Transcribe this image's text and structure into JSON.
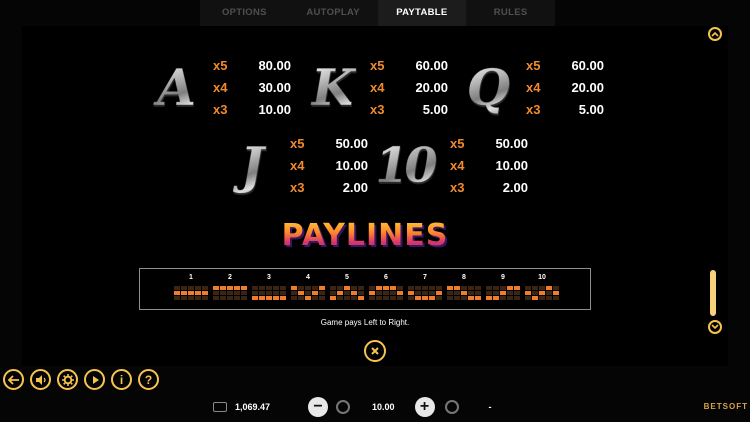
{
  "tabs": [
    {
      "label": "OPTIONS"
    },
    {
      "label": "AUTOPLAY"
    },
    {
      "label": "PAYTABLE",
      "active": true
    },
    {
      "label": "RULES"
    }
  ],
  "symbols": [
    {
      "glyph": "A",
      "pays": [
        {
          "mult": "x5",
          "value": "80.00"
        },
        {
          "mult": "x4",
          "value": "30.00"
        },
        {
          "mult": "x3",
          "value": "10.00"
        }
      ]
    },
    {
      "glyph": "K",
      "pays": [
        {
          "mult": "x5",
          "value": "60.00"
        },
        {
          "mult": "x4",
          "value": "20.00"
        },
        {
          "mult": "x3",
          "value": "5.00"
        }
      ]
    },
    {
      "glyph": "Q",
      "pays": [
        {
          "mult": "x5",
          "value": "60.00"
        },
        {
          "mult": "x4",
          "value": "20.00"
        },
        {
          "mult": "x3",
          "value": "5.00"
        }
      ]
    },
    {
      "glyph": "J",
      "pays": [
        {
          "mult": "x5",
          "value": "50.00"
        },
        {
          "mult": "x4",
          "value": "10.00"
        },
        {
          "mult": "x3",
          "value": "2.00"
        }
      ]
    },
    {
      "glyph": "10",
      "pays": [
        {
          "mult": "x5",
          "value": "50.00"
        },
        {
          "mult": "x4",
          "value": "10.00"
        },
        {
          "mult": "x3",
          "value": "2.00"
        }
      ]
    }
  ],
  "paylines_title": "PAYLINES",
  "paylines": [
    {
      "num": "1",
      "rows": [
        1,
        1,
        1,
        1,
        1
      ]
    },
    {
      "num": "2",
      "rows": [
        0,
        0,
        0,
        0,
        0
      ]
    },
    {
      "num": "3",
      "rows": [
        2,
        2,
        2,
        2,
        2
      ]
    },
    {
      "num": "4",
      "rows": [
        0,
        1,
        2,
        1,
        0
      ]
    },
    {
      "num": "5",
      "rows": [
        2,
        1,
        0,
        1,
        2
      ]
    },
    {
      "num": "6",
      "rows": [
        1,
        0,
        0,
        0,
        1
      ]
    },
    {
      "num": "7",
      "rows": [
        1,
        2,
        2,
        2,
        1
      ]
    },
    {
      "num": "8",
      "rows": [
        0,
        0,
        1,
        2,
        2
      ]
    },
    {
      "num": "9",
      "rows": [
        2,
        2,
        1,
        0,
        0
      ]
    },
    {
      "num": "10",
      "rows": [
        1,
        2,
        1,
        0,
        1
      ]
    }
  ],
  "note": "Game pays Left to Right.",
  "close_icon": "close-icon",
  "controls": {
    "icons": [
      "back-icon",
      "sound-icon",
      "settings-icon",
      "turbo-icon",
      "info-icon",
      "help-icon"
    ],
    "info_glyph": "i",
    "help_glyph": "?"
  },
  "bottom": {
    "balance": "1,069.47",
    "bet": "10.00",
    "win": "-",
    "minus": "−",
    "plus": "+"
  },
  "brand": "BETSOFT",
  "colors": {
    "accent": "#f6c44e",
    "multiplier": "#f08a2c",
    "payline_on": "#f07d2c"
  }
}
